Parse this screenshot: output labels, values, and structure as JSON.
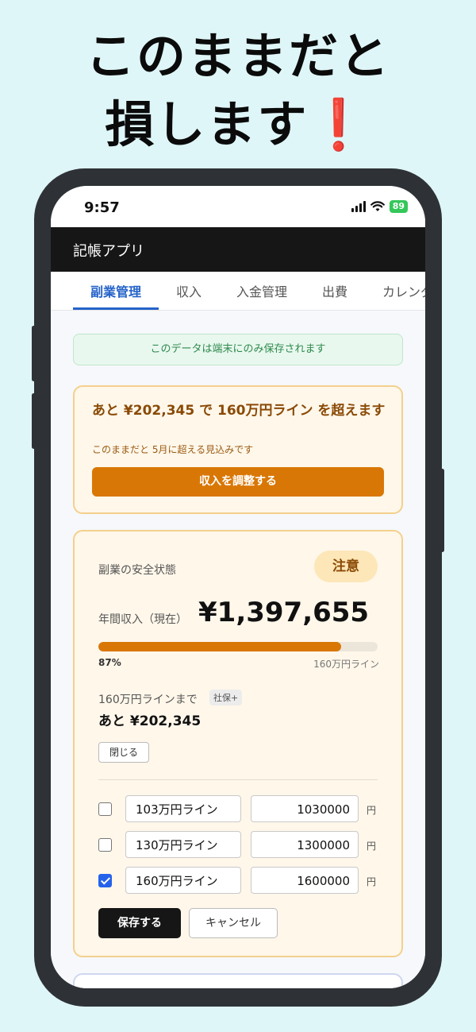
{
  "headline": {
    "line1": "このままだと",
    "line2": "損します",
    "emoji": "❗"
  },
  "status_bar": {
    "time": "9:57",
    "battery": "89"
  },
  "app": {
    "title": "記帳アプリ"
  },
  "tabs": [
    {
      "label": "副業管理",
      "active": true
    },
    {
      "label": "収入",
      "active": false
    },
    {
      "label": "入金管理",
      "active": false
    },
    {
      "label": "出費",
      "active": false
    },
    {
      "label": "カレンダー",
      "active": false
    }
  ],
  "notice": {
    "text": "このデータは端末にのみ保存されます"
  },
  "warning": {
    "message": "あと ¥202,345 で 160万円ライン を超えます",
    "sub": "このままだと 5月に超える見込みです",
    "button": "収入を調整する"
  },
  "status_card": {
    "title": "副業の安全状態",
    "badge": "注意",
    "annual_label": "年間収入（現在）",
    "annual_value": "¥1,397,655",
    "progress_percent": 87,
    "progress_label": "87%",
    "line_label": "160万円ライン",
    "until_label": "160万円ラインまで",
    "until_badge": "社保+",
    "remaining": "あと ¥202,345",
    "close_button": "閉じる",
    "lines": [
      {
        "name": "103万円ライン",
        "amount": "1030000",
        "unit": "円",
        "checked": false
      },
      {
        "name": "130万円ライン",
        "amount": "1300000",
        "unit": "円",
        "checked": false
      },
      {
        "name": "160万円ライン",
        "amount": "1600000",
        "unit": "円",
        "checked": true
      }
    ],
    "save_button": "保存する",
    "cancel_button": "キャンセル"
  },
  "colors": {
    "accent": "#d97706",
    "tab_active": "#2563c9",
    "notice_green": "#2e8a4c",
    "alert_red": "#d21f2a"
  }
}
